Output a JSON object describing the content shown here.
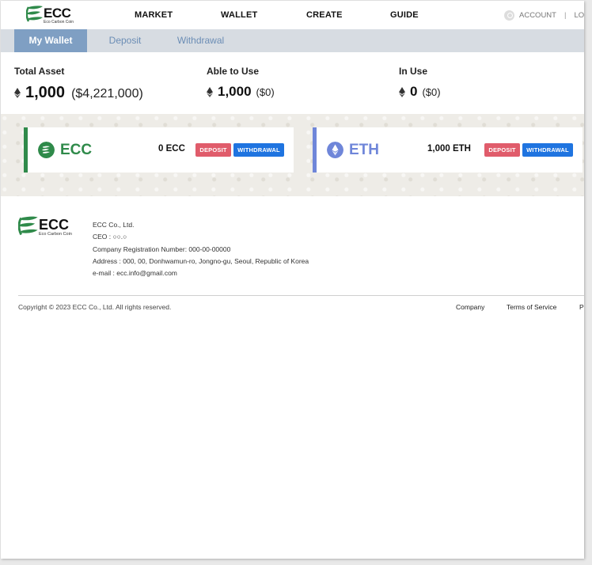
{
  "header": {
    "logo_text": "ECC",
    "logo_sub": "Eco Carbon Coin",
    "nav": [
      "MARKET",
      "WALLET",
      "CREATE",
      "GUIDE"
    ],
    "account_label": "ACCOUNT",
    "logout_label": "LOGOU"
  },
  "tabs": [
    "My Wallet",
    "Deposit",
    "Withdrawal"
  ],
  "assets": {
    "total": {
      "label": "Total Asset",
      "amount": "1,000",
      "usd": "($4,221,000)"
    },
    "able": {
      "label": "Able to Use",
      "amount": "1,000",
      "usd": "($0)"
    },
    "in_use": {
      "label": "In Use",
      "amount": "0",
      "usd": "($0)"
    }
  },
  "wallets": [
    {
      "symbol": "ECC",
      "balance": "0 ECC",
      "deposit_label": "DEPOSIT",
      "withdrawal_label": "WITHDRAWAL",
      "color": "#2f8a4a"
    },
    {
      "symbol": "ETH",
      "balance": "1,000 ETH",
      "deposit_label": "DEPOSIT",
      "withdrawal_label": "WITHDRAWAL",
      "color": "#6f86d9"
    }
  ],
  "footer": {
    "logo_text": "ECC",
    "logo_sub": "Eco Carbon Coin",
    "company": "ECC Co., Ltd.",
    "ceo": "CEO : ○○.○",
    "registration": "Company Registration Number: 000-00-00000",
    "address": "Address : 000, 00, Donhwamun-ro, Jongno-gu, Seoul, Republic of Korea",
    "email": "e-mail : ecc.info@gmail.com",
    "copyright": "Copyright © 2023 ECC Co., Ltd. All rights reserved.",
    "links": [
      "Company",
      "Terms of Service",
      "P"
    ]
  },
  "colors": {
    "tab_active": "#7f9fc3",
    "tab_bar": "#d7dce2",
    "deposit": "#e05c6b",
    "withdrawal": "#1f74e0"
  }
}
